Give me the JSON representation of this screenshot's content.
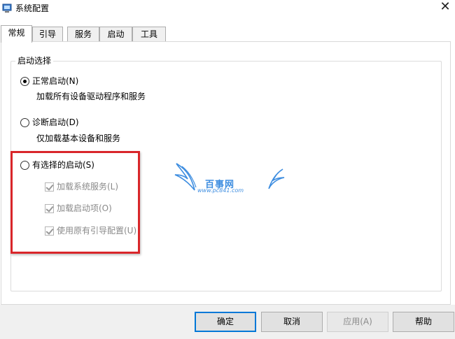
{
  "window": {
    "title": "系统配置",
    "close_glyph": "✕"
  },
  "tabs": [
    {
      "label": "常规",
      "active": true
    },
    {
      "label": "引导",
      "active": false
    },
    {
      "label": "服务",
      "active": false
    },
    {
      "label": "启动",
      "active": false
    },
    {
      "label": "工具",
      "active": false
    }
  ],
  "startup_selection": {
    "group_title": "启动选择",
    "normal": {
      "label": "正常启动(N)",
      "description": "加载所有设备驱动程序和服务",
      "checked": true
    },
    "diagnostic": {
      "label": "诊断启动(D)",
      "description": "仅加载基本设备和服务",
      "checked": false
    },
    "selective": {
      "label": "有选择的启动(S)",
      "checked": false,
      "options": [
        {
          "label": "加载系统服务(L)",
          "checked": true,
          "enabled": false
        },
        {
          "label": "加载启动项(O)",
          "checked": true,
          "enabled": false
        },
        {
          "label": "使用原有引导配置(U)",
          "checked": true,
          "enabled": false
        }
      ]
    }
  },
  "watermark": {
    "text": "百事网",
    "url": "www.pc841.com",
    "color": "#3d8de0"
  },
  "buttons": {
    "ok": "确定",
    "cancel": "取消",
    "apply": "应用(A)",
    "help": "帮助"
  },
  "colors": {
    "highlight": "#d9262a",
    "default_button_border": "#0078d7"
  }
}
